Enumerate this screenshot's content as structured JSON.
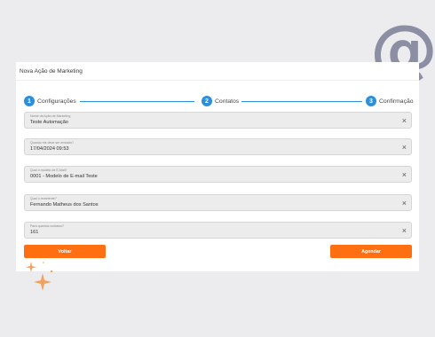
{
  "decoration": {
    "at_symbol": "@"
  },
  "card": {
    "title": "Nova Ação de Marketing"
  },
  "stepper": {
    "steps": [
      {
        "number": "1",
        "label": "Configurações"
      },
      {
        "number": "2",
        "label": "Contatos"
      },
      {
        "number": "3",
        "label": "Confirmação"
      }
    ],
    "accent_color": "#2b8fdc"
  },
  "fields": [
    {
      "label": "Nome da Ação de Marketing",
      "value": "Teste Automação"
    },
    {
      "label": "Quando ele deve ser enviado?",
      "value": "17/04/2024 09:53"
    },
    {
      "label": "Qual o modelo de E-Mail?",
      "value": "0001 - Modelo de E-mail Teste"
    },
    {
      "label": "Qual o remetente?",
      "value": "Fernando Matheus dos Santos"
    },
    {
      "label": "Para quantos contatos?",
      "value": "161"
    }
  ],
  "clear_icon": "×",
  "buttons": {
    "back_label": "Voltar",
    "schedule_label": "Agendar"
  },
  "colors": {
    "button": "#fd6f11",
    "sparkle": "#f4a15c",
    "at_symbol": "#8c8fa4"
  }
}
